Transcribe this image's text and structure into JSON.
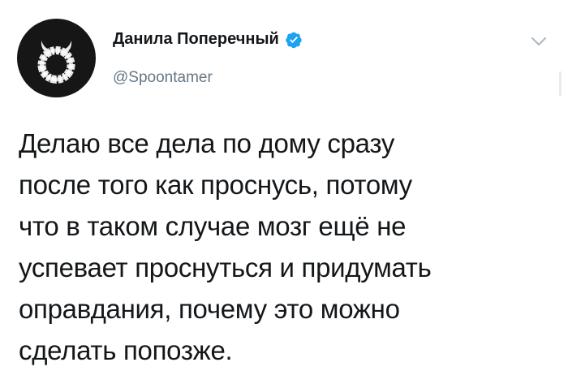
{
  "author": {
    "display_name": "Данила Поперечный",
    "handle": "@Spoontamer",
    "verified": true
  },
  "icons": {
    "verified": "verified-badge-icon",
    "menu": "chevron-down-icon"
  },
  "tweet": {
    "lines": [
      "Делаю все дела по дому сразу",
      "после того как проснусь, потому",
      "что в таком случае мозг ещё не",
      "успевает проснуться и придумать",
      "оправдания, почему это можно",
      "сделать попозже."
    ]
  },
  "colors": {
    "verified_blue": "#1da1f2",
    "text": "#14171a",
    "secondary_text": "#657786",
    "avatar_bg": "#161616"
  }
}
